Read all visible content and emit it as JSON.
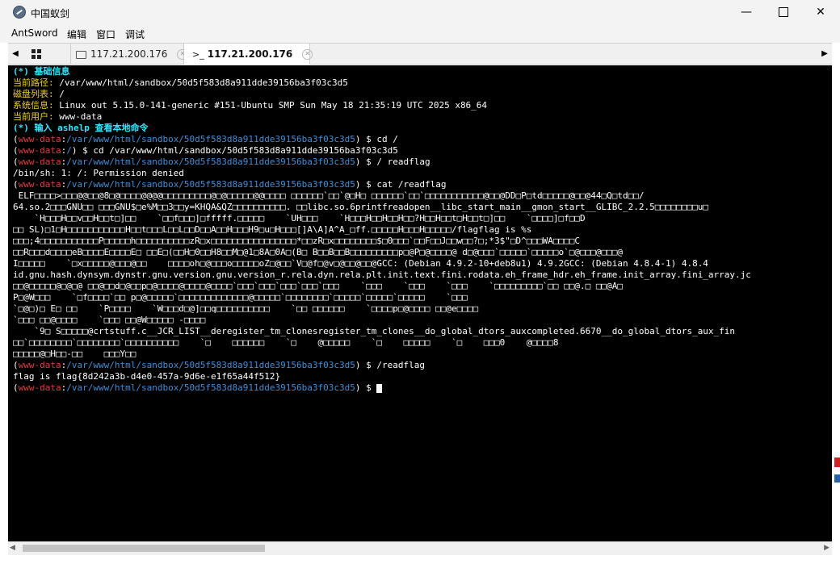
{
  "window": {
    "title": "中国蚁剑",
    "controls": {
      "minimize": "—",
      "maximize": "",
      "close": "✕"
    }
  },
  "menu": [
    "AntSword",
    "编辑",
    "窗口",
    "调试"
  ],
  "tabs": {
    "left_arrow": "◀",
    "right_arrow": "▶",
    "items": [
      {
        "label": "117.21.200.176",
        "icon": "folder-icon",
        "close": "✕",
        "active": false
      },
      {
        "label": "117.21.200.176",
        "icon": "terminal-icon",
        "prefix": ">_",
        "close": "✕",
        "active": true
      }
    ]
  },
  "terminal": {
    "header_title": "(*) 基础信息",
    "path_label": "当前路径:",
    "path_value": " /var/www/html/sandbox/50d5f583d8a911dde39156ba3f03c3d5",
    "disk_label": "磁盘列表:",
    "disk_value": " /",
    "sys_label": "系统信息:",
    "sys_value": " Linux out 5.15.0-141-generic #151-Ubuntu SMP Sun May 18 21:35:19 UTC 2025 x86_64",
    "user_label": "当前用户:",
    "user_value": " www-data",
    "help_line": "(*) 输入 ashelp 查看本地命令",
    "prompt_user": "www-data",
    "prompt_dir": "/var/www/html/sandbox/50d5f583d8a911dde39156ba3f03c3d5",
    "prompt_root": "/",
    "prompt_suffix": ") $ ",
    "cmd1": "cd /",
    "cmd2": "cd /var/www/html/sandbox/50d5f583d8a911dde39156ba3f03c3d5",
    "cmd3": "/ readflag",
    "out3": "/bin/sh: 1: /: Permission denied",
    "cmd4": "cat /readflag",
    "binary_lines": [
      " ELF□□□□>□□□@@□□@8□@□□□□@@@@□□□□□□□□□@□@□□□□□@@□□□□ □□□□□□`□□`@□H□ □□□□□□`□□`□□□□□□□□□□□@□□@DD□P□td□□□□□@□□@44□Q□td□□/",
      "64.so.2□□□GNU□□ □□□GNU$□e%M□□3□□y=KHQA&QZ□□□□□□□□□□. □□libc.so.6printfreadopen__libc_start_main__gmon_start__GLIBC_2.2.5□□□□□□□□u□",
      "    `H□□□H□□v□□H□□t□]□□    `□□f□□□]□fffff.□□□□□    `UH□□□    `H□□□H□□H□□H□□?H□□H□□t□H□□t□]□□    `□□□□]□f□□D",
      "□□ SL)□1□H□□□□□□□□□□□H□□t□□□L□□L□□D□□A□□H□□□H9□u□H□□□[]A\\A]A^A_□ff.□□□□□H□□□H□□□□□/flagflag is %s",
      "□□□;4□□□□□□□□□□□P□□□□□h□□□□□□□□□□zR□x□□□□□□□□□□□□□□□□*□□zR□x□□□□□□□□$□0□□□`□□F□□J□□w□□?□;*3$\"□D^□□□WA□□□□C",
      "□□R□□□d□□□□eB□□□□E□□□□E□ □□E□(□□H□0□□H8□□M□@1□8A□0A□(B□ B□□B□□B□□□□□□□□□p□@P□@□□□□@ d□@□□□`□□□□□`□□□□□o`□@□□□@□□□@",
      "I□□□□□    `□x□□□□□@□□□@□□    □□□□oh□@□□□o□□□□□oZ□@□□`V□@f□@v□@□□@□□@GCC: (Debian 4.9.2-10+deb8u1) 4.9.2GCC: (Debian 4.8.4-1) 4.8.4",
      "id.gnu.hash.dynsym.dynstr.gnu.version.gnu.version_r.rela.dyn.rela.plt.init.text.fini.rodata.eh_frame_hdr.eh_frame.init_array.fini_array.jc",
      "□□@□□□□□@□@□@ □□@□□d□@□□p□@□□□□@□□□□@□□□□`□□□`□□□`□□□`□□□`□□□    `□□□    `□□□    `□□□    `□□□□□□□□□`□□ □□@.□ □□@A□",
      "P□@W□□□    `□f□□□□`□□ p□@□□□□□`□□□□□□□□□□□□□@□□□□□`□□□□□□□□`□□□□□`□□□□□`□□□□□    `□□□",
      "`□@□)□ E□ □□    `P□□□□    `W□□□d□@]□□q□□□□□□□□□□    `□□ □□□□□□    `□□□□p□@□□□□ □□@e□□□□",
      "`□□□ □□@□□□□    `□□□ □□@W□□□□□ -□□□□",
      "    `9□ S□□□□□@crtstuff.c__JCR_LIST__deregister_tm_clonesregister_tm_clones__do_global_dtors_auxcompleted.6670__do_global_dtors_aux_fin",
      "□□`□□□□□□□□`□□□□□□□□`□□□□□□□□□□    `□    □□□□□□    `□    @□□□□□    `□    □□□□□    `□    □□□0    @□□□□8",
      "□□□□□@□H□□-□□    □□□Y□□"
    ],
    "cmd5": "/readflag",
    "out5": "flag is flag{8d242a3b-d4e0-457a-9d6e-e1f65a44f512}"
  },
  "colors": {
    "terminal_bg": "#000000",
    "cyan": "#2ee6ff",
    "yellow": "#f0d020",
    "red": "#e23b3b",
    "path_blue": "#3a8fd8"
  },
  "scrollbar": {
    "left_arrow": "◀",
    "right_arrow": "▶"
  }
}
